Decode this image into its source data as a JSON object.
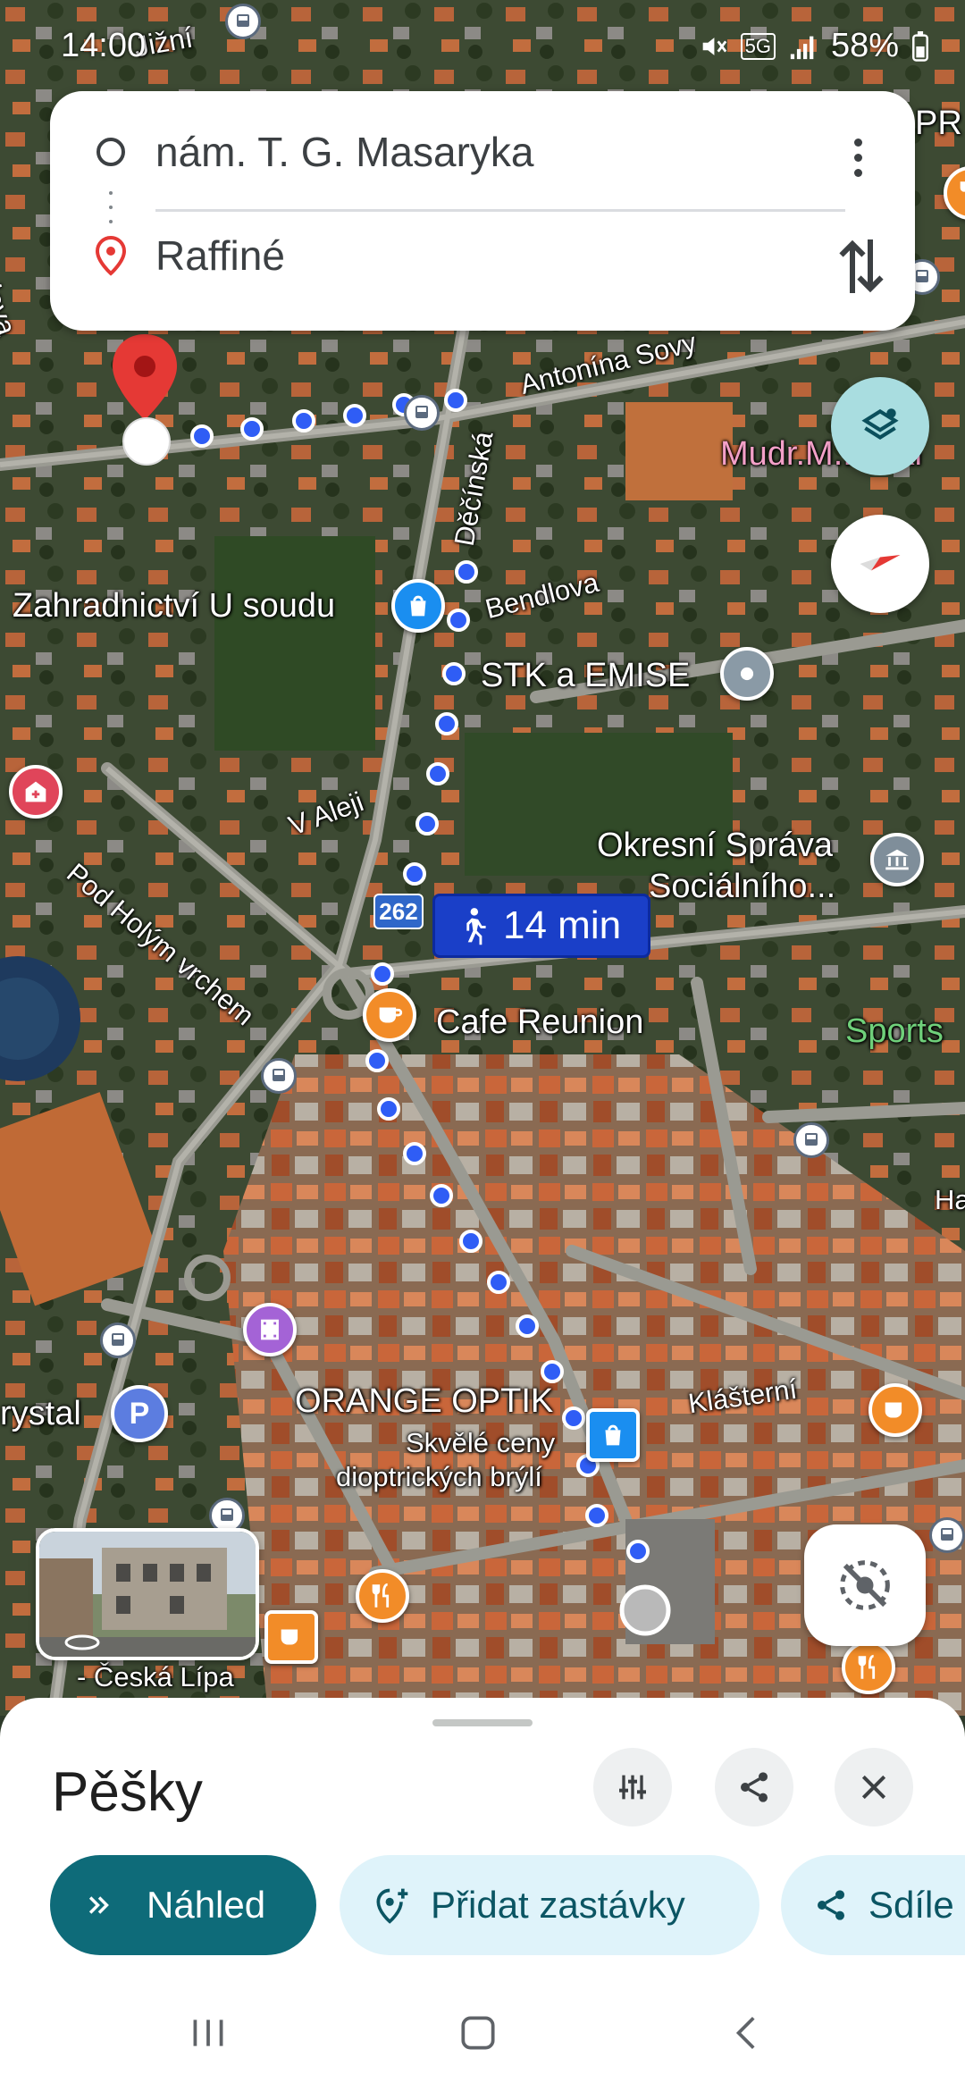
{
  "status_bar": {
    "time": "14:00",
    "battery": "58%",
    "network": "5G"
  },
  "route_card": {
    "origin": "nám. T. G. Masaryka",
    "destination": "Raffiné"
  },
  "map": {
    "labels": {
      "street_jizni": "Jižní",
      "street_antonina_sovy": "Antonína Sovy",
      "street_decinska": "Děčínská",
      "street_bendlova": "Bendlova",
      "street_v_aleji": "V Aleji",
      "street_pod_holym_vrchem": "Pod Holým vrchem",
      "street_klasterni": "Klášterní",
      "place_zahradnictvi": "Zahradnictví U soudu",
      "place_stk": "STK a EMISE",
      "place_okresni_1": "Okresní Správa",
      "place_okresni_2": "Sociálního...",
      "place_cafe": "Cafe Reunion",
      "place_mudr": "Mudr.M...oski",
      "place_sports": "Sports",
      "place_orange_optik": "ORANGE OPTIK",
      "place_optik_sub_1": "Skvělé ceny",
      "place_optik_sub_2": "dioptrických brýlí",
      "place_crystal": "rystal",
      "place_pr": "PR",
      "place_ha": "Ha",
      "place_ceska_lipa": "- Česká Lípa",
      "edge_left": "lova"
    },
    "road_number": "262",
    "duration": "14 min",
    "accent_route": "#2f5df5",
    "accent_pin": "#e53935"
  },
  "sheet": {
    "title": "Pěšky",
    "preview_label": "Náhled",
    "add_stops_label": "Přidat zastávky",
    "share_label": "Sdíle"
  },
  "icons": {
    "options": "tune-icon",
    "share": "share-icon",
    "close": "close-icon",
    "layers": "layers-icon",
    "compass": "compass-icon",
    "recenter": "location-off-icon",
    "swap": "swap-vertical-icon",
    "walk": "walk-icon"
  }
}
